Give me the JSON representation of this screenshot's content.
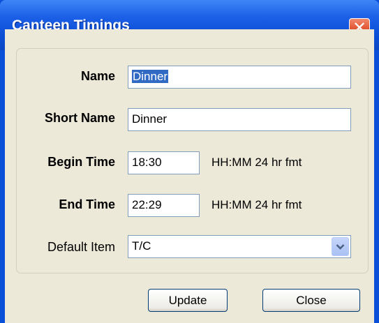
{
  "window": {
    "title": "Canteen Timings",
    "close_glyph": "✕"
  },
  "form": {
    "name_label": "Name",
    "name_value": "Dinner",
    "short_name_label": "Short Name",
    "short_name_value": "Dinner",
    "begin_time_label": "Begin Time",
    "begin_time_value": "18:30",
    "begin_time_hint": "HH:MM 24 hr fmt",
    "end_time_label": "End Time",
    "end_time_value": "22:29",
    "end_time_hint": "HH:MM 24 hr fmt",
    "default_item_label": "Default Item",
    "default_item_value": "T/C"
  },
  "buttons": {
    "update_label": "Update",
    "close_label": "Close"
  },
  "icons": {
    "close": "close-icon",
    "dropdown": "chevron-down-icon"
  },
  "colors": {
    "titlebar": "#0a4fd8",
    "close_button": "#e0502d",
    "dialog_background": "#ece9d8",
    "selection": "#316ac5"
  }
}
